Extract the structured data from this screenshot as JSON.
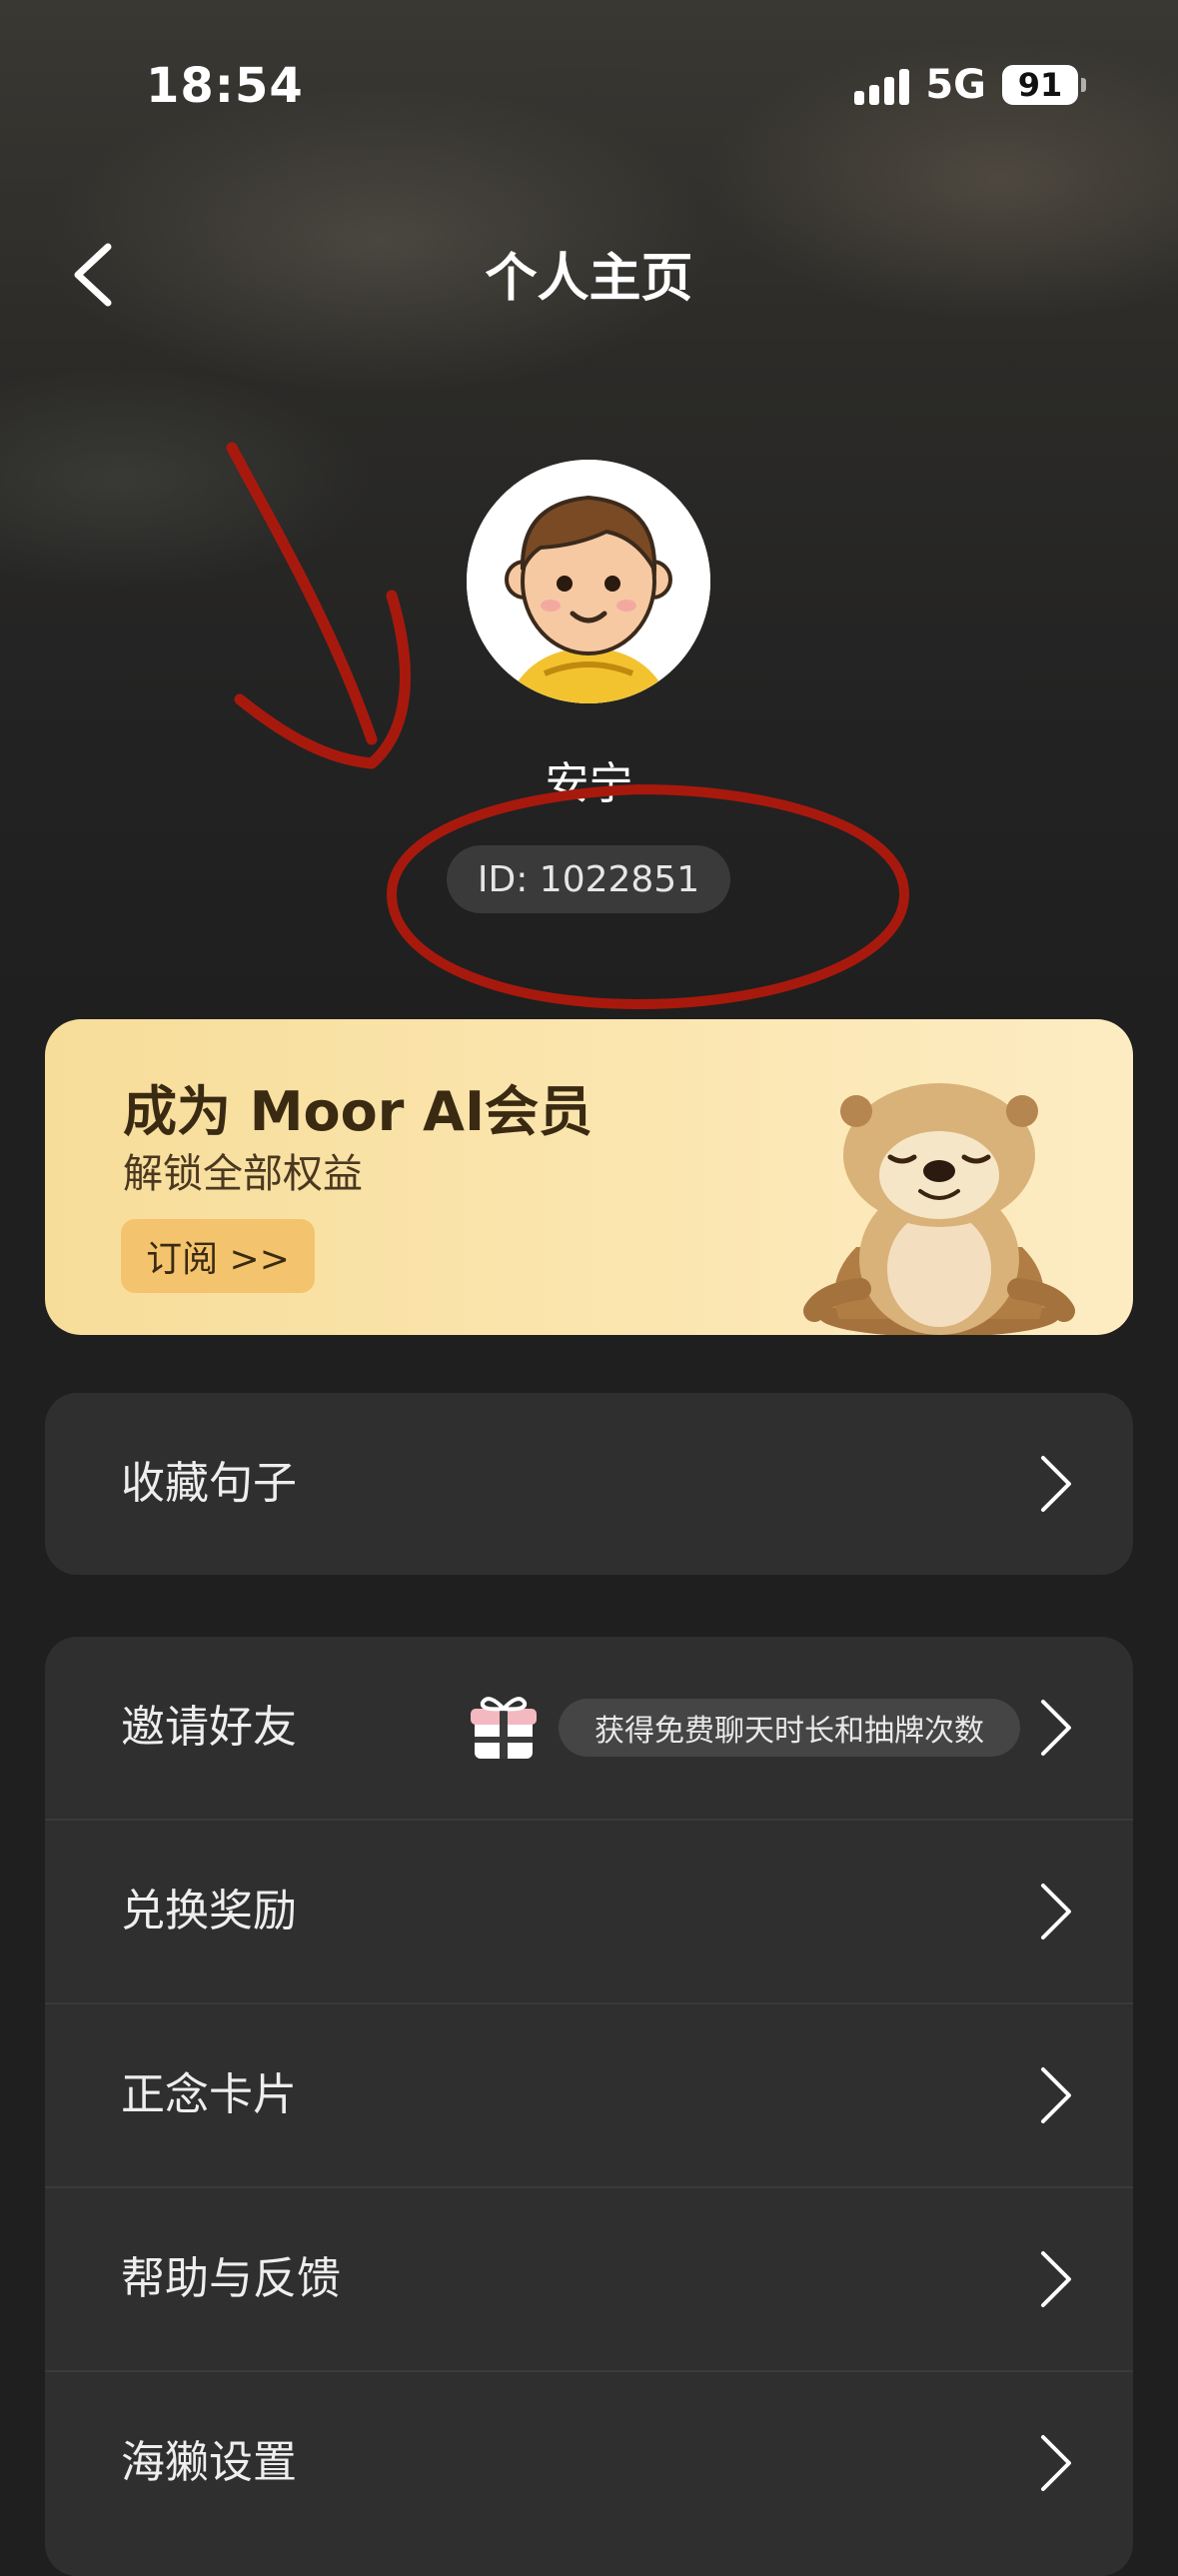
{
  "status_bar": {
    "time": "18:54",
    "network": "5G",
    "battery": "91"
  },
  "nav": {
    "title": "个人主页"
  },
  "profile": {
    "username": "安宁",
    "id_text": "ID: 1022851"
  },
  "member_banner": {
    "title": "成为 Moor AI会员",
    "subtitle": "解锁全部权益",
    "button_label": "订阅 >>"
  },
  "menu": {
    "favorites": {
      "label": "收藏句子"
    },
    "invite": {
      "label": "邀请好友",
      "tip": "获得免费聊天时长和抽牌次数"
    },
    "items": [
      {
        "label": "兑换奖励"
      },
      {
        "label": "正念卡片"
      },
      {
        "label": "帮助与反馈"
      },
      {
        "label": "海獭设置"
      }
    ]
  },
  "colors": {
    "accent_gold": "#f7dd9a",
    "annotation_red": "#b01c0e",
    "background": "#1f1f1f",
    "card": "#2f2f2f"
  }
}
